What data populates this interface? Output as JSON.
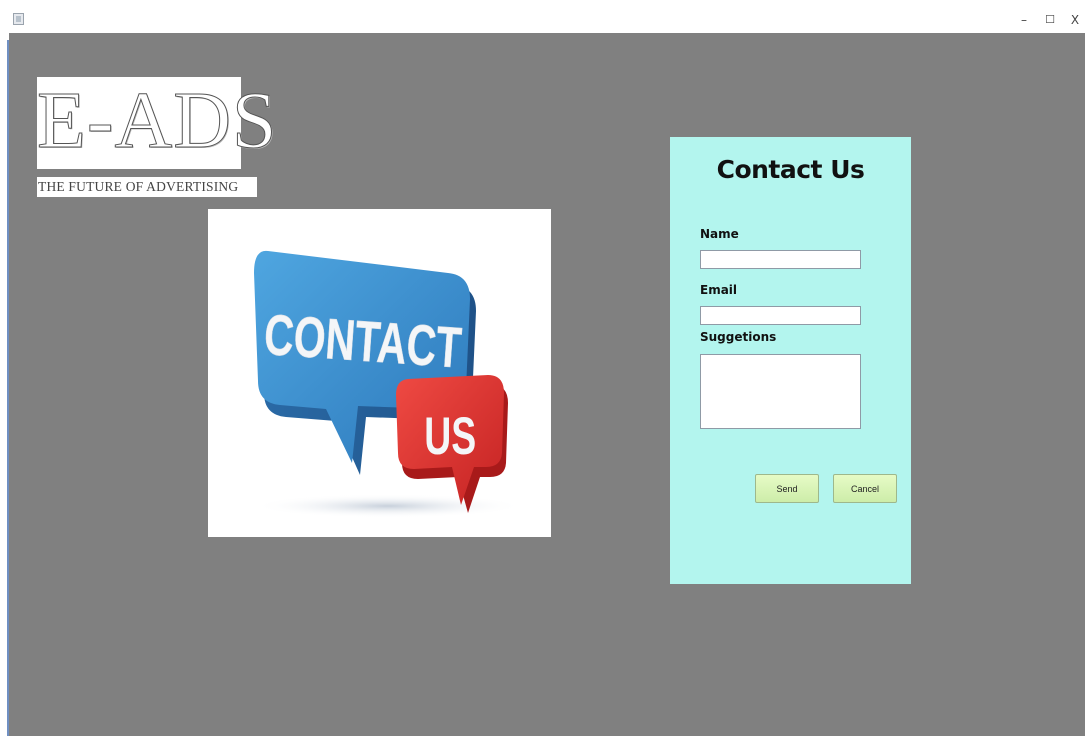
{
  "window": {
    "controls": {
      "minimize": "–",
      "maximize": "☐",
      "close": "X"
    }
  },
  "logo": {
    "title": "E-ADS",
    "tagline": "THE FUTURE OF ADVERTISING"
  },
  "illustration": {
    "big_bubble_text": "CONTACT",
    "small_bubble_text": "US",
    "colors": {
      "big_bubble": "#3a8fcf",
      "small_bubble": "#d8302f"
    }
  },
  "contact_form": {
    "title": "Contact Us",
    "name_label": "Name",
    "name_value": "",
    "email_label": "Email",
    "email_value": "",
    "suggestions_label": "Suggetions",
    "suggestions_value": "",
    "send_label": "Send",
    "cancel_label": "Cancel",
    "panel_color": "#b3f5ee"
  },
  "colors": {
    "background": "#808080"
  }
}
